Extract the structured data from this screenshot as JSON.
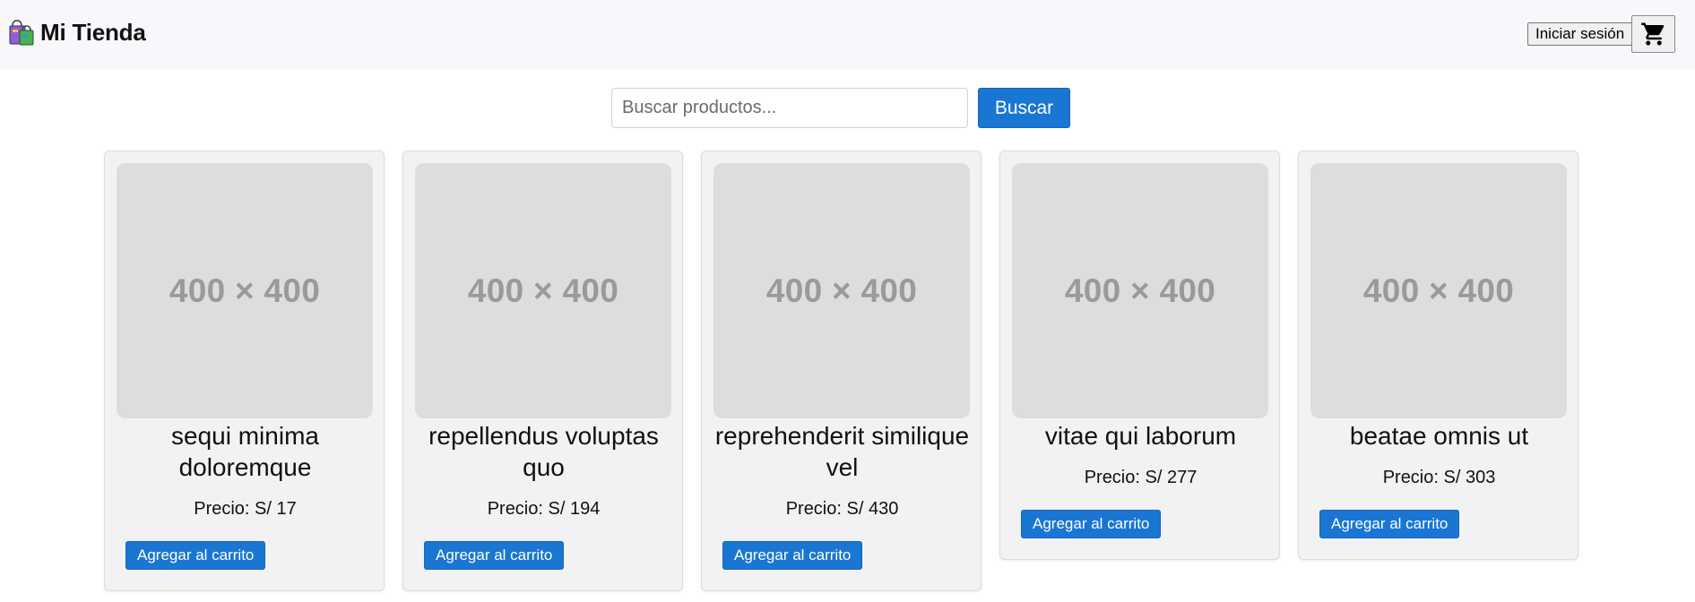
{
  "header": {
    "brand_icon": "shopping-bags-icon",
    "brand_name": "Mi Tienda",
    "login_label": "Iniciar sesión",
    "cart_icon": "shopping-cart-icon"
  },
  "search": {
    "placeholder": "Buscar productos...",
    "value": "",
    "button_label": "Buscar"
  },
  "products": [
    {
      "image_placeholder": "400 × 400",
      "name": "sequi minima doloremque",
      "price": "Precio: S/ 17",
      "add_label": "Agregar al carrito"
    },
    {
      "image_placeholder": "400 × 400",
      "name": "repellendus voluptas quo",
      "price": "Precio: S/ 194",
      "add_label": "Agregar al carrito"
    },
    {
      "image_placeholder": "400 × 400",
      "name": "reprehenderit similique vel",
      "price": "Precio: S/ 430",
      "add_label": "Agregar al carrito"
    },
    {
      "image_placeholder": "400 × 400",
      "name": "vitae qui laborum",
      "price": "Precio: S/ 277",
      "add_label": "Agregar al carrito"
    },
    {
      "image_placeholder": "400 × 400",
      "name": "beatae omnis ut",
      "price": "Precio: S/ 303",
      "add_label": "Agregar al carrito"
    }
  ],
  "colors": {
    "primary": "#1976d2",
    "header_bg": "#f8f8fc",
    "card_bg": "#f2f2f4",
    "image_placeholder_bg": "#dddddd"
  }
}
